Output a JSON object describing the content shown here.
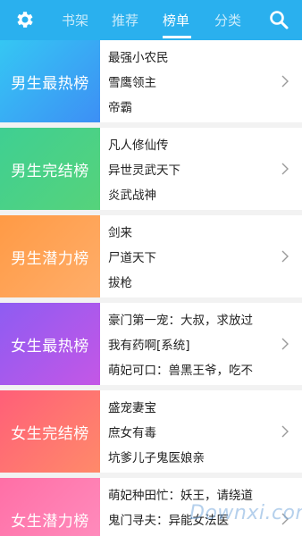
{
  "header": {
    "tabs": [
      {
        "label": "书架"
      },
      {
        "label": "推荐"
      },
      {
        "label": "榜单"
      },
      {
        "label": "分类"
      }
    ],
    "active_tab": "榜单",
    "settings_icon": "gear-icon",
    "search_icon": "search-icon",
    "color": "#2ab0ee"
  },
  "rankings": [
    {
      "title": "男生最热榜",
      "colors": [
        "#35c7f3",
        "#3d8ff5"
      ],
      "books": [
        "最强小农民",
        "雪鹰领主",
        "帝霸"
      ]
    },
    {
      "title": "男生完结榜",
      "colors": [
        "#3fcf92",
        "#56d37b"
      ],
      "books": [
        "凡人修仙传",
        "异世灵武天下",
        "炎武战神"
      ]
    },
    {
      "title": "男生潜力榜",
      "colors": [
        "#ff9a45",
        "#ffae6a"
      ],
      "books": [
        "剑来",
        "尸道天下",
        "拔枪"
      ]
    },
    {
      "title": "女生最热榜",
      "colors": [
        "#8e5cf2",
        "#c457e6"
      ],
      "books": [
        "豪门第一宠：大叔，求放过",
        "我有药啊[系统]",
        "萌妃可口：兽黑王爷，吃不"
      ]
    },
    {
      "title": "女生完结榜",
      "colors": [
        "#ff5f78",
        "#ff8a6a"
      ],
      "books": [
        "盛宠妻宝",
        "庶女有毒",
        "坑爹儿子鬼医娘亲"
      ]
    },
    {
      "title": "女生潜力榜",
      "colors": [
        "#ff6fa6",
        "#ff8fbf"
      ],
      "books": [
        "萌妃种田忙：妖王，请绕道",
        "鬼门寻夫：异能女法医"
      ]
    }
  ],
  "watermark": "Downxi.com"
}
